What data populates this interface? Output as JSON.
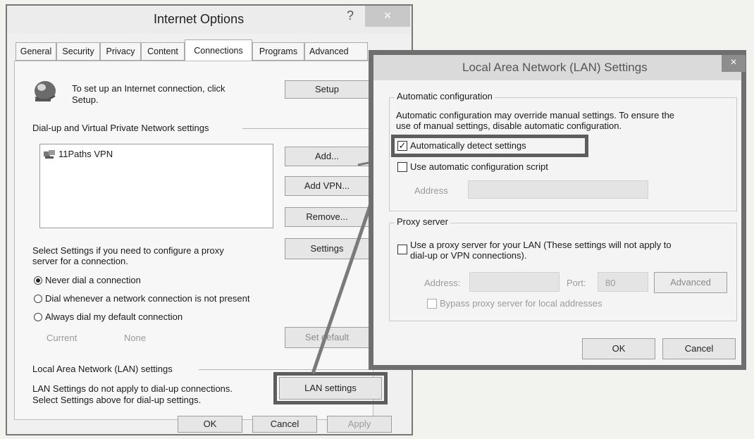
{
  "internet_options": {
    "title": "Internet Options",
    "help_glyph": "?",
    "close_glyph": "×",
    "tabs": [
      "General",
      "Security",
      "Privacy",
      "Content",
      "Connections",
      "Programs",
      "Advanced"
    ],
    "active_tab": "Connections",
    "setup_text_1": "To set up an Internet connection, click",
    "setup_text_2": "Setup.",
    "setup_button": "Setup",
    "dialup_heading": "Dial-up and Virtual Private Network settings",
    "vpn_list": [
      "11Paths VPN"
    ],
    "add_button": "Add...",
    "add_vpn_button": "Add VPN...",
    "remove_button": "Remove...",
    "settings_text_1": "Select Settings if you need to configure a proxy",
    "settings_text_2": "server for a connection.",
    "settings_button": "Settings",
    "radios": [
      {
        "label": "Never dial a connection",
        "selected": true
      },
      {
        "label": "Dial whenever a network connection is not present",
        "selected": false
      },
      {
        "label": "Always dial my default connection",
        "selected": false
      }
    ],
    "current_label": "Current",
    "current_value": "None",
    "set_default_button": "Set default",
    "lan_heading": "Local Area Network (LAN) settings",
    "lan_text_1": "LAN Settings do not apply to dial-up connections.",
    "lan_text_2": "Select Settings above for dial-up settings.",
    "lan_settings_button": "LAN settings",
    "ok_button": "OK",
    "cancel_button": "Cancel",
    "apply_button": "Apply"
  },
  "lan_dialog": {
    "title": "Local Area Network (LAN) Settings",
    "close_glyph": "×",
    "auto_config_heading": "Automatic configuration",
    "auto_config_text_1": "Automatic configuration may override manual settings.  To ensure the",
    "auto_config_text_2": "use of manual settings, disable automatic configuration.",
    "auto_detect_label": "Automatically detect settings",
    "auto_detect_checked": true,
    "auto_script_label": "Use automatic configuration script",
    "auto_script_checked": false,
    "address_label": "Address",
    "proxy_heading": "Proxy server",
    "proxy_label_1": "Use a proxy server for your LAN (These settings will not apply to",
    "proxy_label_2": "dial-up or VPN connections).",
    "proxy_checked": false,
    "proxy_address_label": "Address:",
    "port_label": "Port:",
    "port_value": "80",
    "advanced_button": "Advanced",
    "bypass_label": "Bypass proxy server for local addresses",
    "bypass_checked": false,
    "ok_button": "OK",
    "cancel_button": "Cancel",
    "check_glyph": "✓"
  },
  "colors": {
    "highlight_box": "#5d5d5d",
    "arrow": "#7a7a7a",
    "lan_border": "#6f6f6f"
  }
}
